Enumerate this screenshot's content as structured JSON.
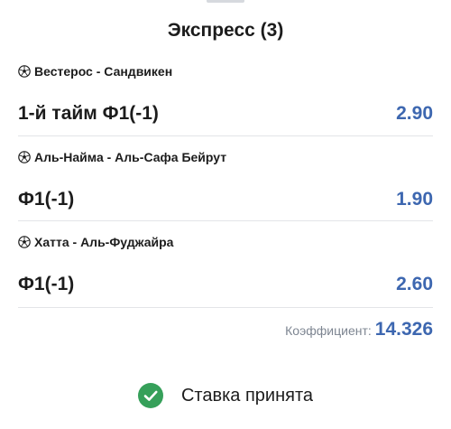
{
  "title": "Экспресс (3)",
  "bets": [
    {
      "event": "Вестерос - Сандвикен",
      "market": "1-й тайм Ф1(-1)",
      "odds": "2.90"
    },
    {
      "event": "Аль-Найма - Аль-Сафа Бейрут",
      "market": "Ф1(-1)",
      "odds": "1.90"
    },
    {
      "event": "Хатта - Аль-Фуджайра",
      "market": "Ф1(-1)",
      "odds": "2.60"
    }
  ],
  "total": {
    "label": "Коэффициент:",
    "value": "14.326"
  },
  "status": {
    "text": "Ставка принята",
    "icon": "check-circle-icon"
  },
  "colors": {
    "accent": "#3d67b0",
    "success": "#36a05a",
    "text": "#1c1c1c",
    "muted": "#7d8591",
    "divider": "#e3e5e8"
  }
}
